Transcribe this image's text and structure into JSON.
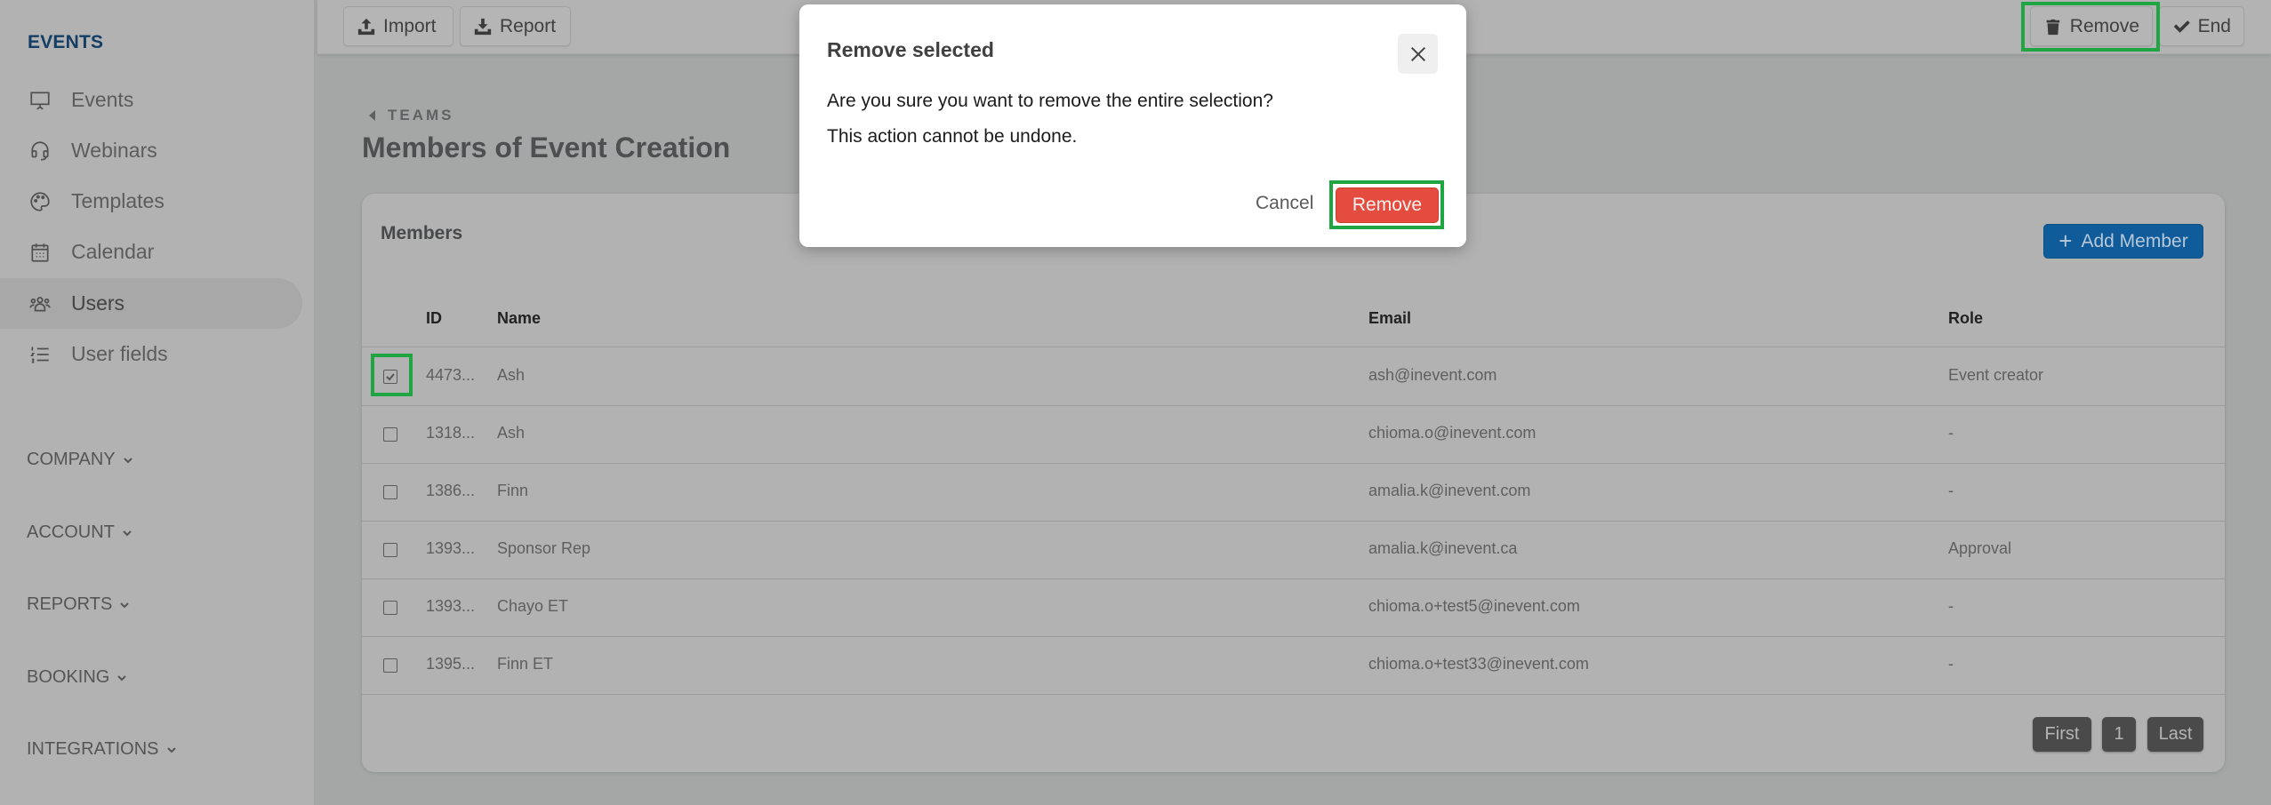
{
  "sidebar": {
    "section_title": "EVENTS",
    "items": [
      {
        "label": "Events",
        "icon": "presentation-board-icon",
        "active": false
      },
      {
        "label": "Webinars",
        "icon": "headset-icon",
        "active": false
      },
      {
        "label": "Templates",
        "icon": "palette-icon",
        "active": false
      },
      {
        "label": "Calendar",
        "icon": "calendar-icon",
        "active": false
      },
      {
        "label": "Users",
        "icon": "users-icon",
        "active": true
      },
      {
        "label": "User fields",
        "icon": "numbered-list-icon",
        "active": false
      }
    ],
    "groups": [
      {
        "label": "COMPANY"
      },
      {
        "label": "ACCOUNT"
      },
      {
        "label": "REPORTS"
      },
      {
        "label": "BOOKING"
      },
      {
        "label": "INTEGRATIONS"
      }
    ]
  },
  "toolbar": {
    "import_label": "Import",
    "report_label": "Report",
    "remove_label": "Remove",
    "end_label": "End"
  },
  "breadcrumb": {
    "label": "TEAMS"
  },
  "page_title": "Members of Event Creation",
  "members_card": {
    "title": "Members",
    "add_button": "Add Member",
    "columns": [
      "ID",
      "Name",
      "Email",
      "Role"
    ],
    "rows": [
      {
        "checked": true,
        "id": "4473...",
        "name": "Ash",
        "email": "ash@inevent.com",
        "role": "Event creator"
      },
      {
        "checked": false,
        "id": "1318...",
        "name": "Ash",
        "email": "chioma.o@inevent.com",
        "role": "-"
      },
      {
        "checked": false,
        "id": "1386...",
        "name": "Finn",
        "email": "amalia.k@inevent.com",
        "role": "-"
      },
      {
        "checked": false,
        "id": "1393...",
        "name": "Sponsor Rep",
        "email": "amalia.k@inevent.ca",
        "role": "Approval"
      },
      {
        "checked": false,
        "id": "1393...",
        "name": "Chayo ET",
        "email": "chioma.o+test5@inevent.com",
        "role": "-"
      },
      {
        "checked": false,
        "id": "1395...",
        "name": "Finn ET",
        "email": "chioma.o+test33@inevent.com",
        "role": "-"
      }
    ],
    "pagination": {
      "first": "First",
      "page": "1",
      "last": "Last"
    }
  },
  "modal": {
    "title": "Remove selected",
    "message": "Are you sure you want to remove the entire selection?",
    "warning": "This action cannot be undone.",
    "cancel_label": "Cancel",
    "confirm_label": "Remove"
  },
  "colors": {
    "brand_blue": "#105b9a",
    "danger_red": "#e44c3f",
    "highlight_green": "#1fa643",
    "section_title": "#153e64"
  }
}
